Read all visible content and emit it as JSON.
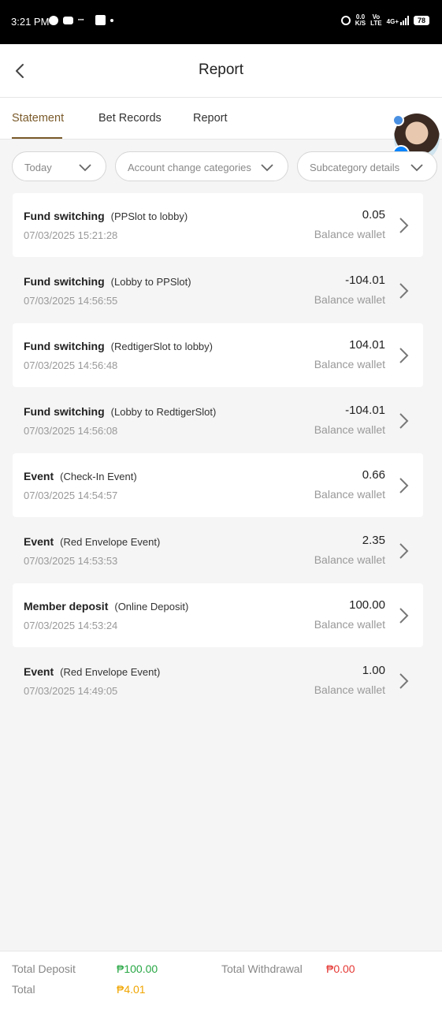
{
  "status_bar": {
    "time": "3:21 PM",
    "speed_top": "0.0",
    "speed_bottom": "K/S",
    "net_top": "Vo",
    "net_bottom": "LTE",
    "signal": "4G+",
    "battery": "78"
  },
  "header": {
    "title": "Report"
  },
  "tabs": [
    {
      "label": "Statement"
    },
    {
      "label": "Bet Records"
    },
    {
      "label": "Report"
    }
  ],
  "filters": {
    "date": "Today",
    "account_change": "Account change categories",
    "subcategory": "Subcategory details"
  },
  "records": [
    {
      "name": "Fund switching",
      "detail": "(PPSlot to lobby)",
      "date": "07/03/2025 15:21:28",
      "amount": "0.05",
      "wallet": "Balance wallet"
    },
    {
      "name": "Fund switching",
      "detail": "(Lobby to PPSlot)",
      "date": "07/03/2025 14:56:55",
      "amount": "-104.01",
      "wallet": "Balance wallet"
    },
    {
      "name": "Fund switching",
      "detail": "(RedtigerSlot to lobby)",
      "date": "07/03/2025 14:56:48",
      "amount": "104.01",
      "wallet": "Balance wallet"
    },
    {
      "name": "Fund switching",
      "detail": "(Lobby to RedtigerSlot)",
      "date": "07/03/2025 14:56:08",
      "amount": "-104.01",
      "wallet": "Balance wallet"
    },
    {
      "name": "Event",
      "detail": "(Check-In Event)",
      "date": "07/03/2025 14:54:57",
      "amount": "0.66",
      "wallet": "Balance wallet"
    },
    {
      "name": "Event",
      "detail": "(Red Envelope Event)",
      "date": "07/03/2025 14:53:53",
      "amount": "2.35",
      "wallet": "Balance wallet"
    },
    {
      "name": "Member deposit",
      "detail": "(Online Deposit)",
      "date": "07/03/2025 14:53:24",
      "amount": "100.00",
      "wallet": "Balance wallet"
    },
    {
      "name": "Event",
      "detail": "(Red Envelope Event)",
      "date": "07/03/2025 14:49:05",
      "amount": "1.00",
      "wallet": "Balance wallet"
    }
  ],
  "summary": {
    "total_deposit_label": "Total Deposit",
    "total_deposit": "₱100.00",
    "total_withdrawal_label": "Total Withdrawal",
    "total_withdrawal": "₱0.00",
    "total_label": "Total",
    "total": "₱4.01"
  },
  "colors": {
    "accent": "#7a5a2a",
    "deposit": "#28a745",
    "withdrawal": "#e53935",
    "total": "#f0a500"
  }
}
